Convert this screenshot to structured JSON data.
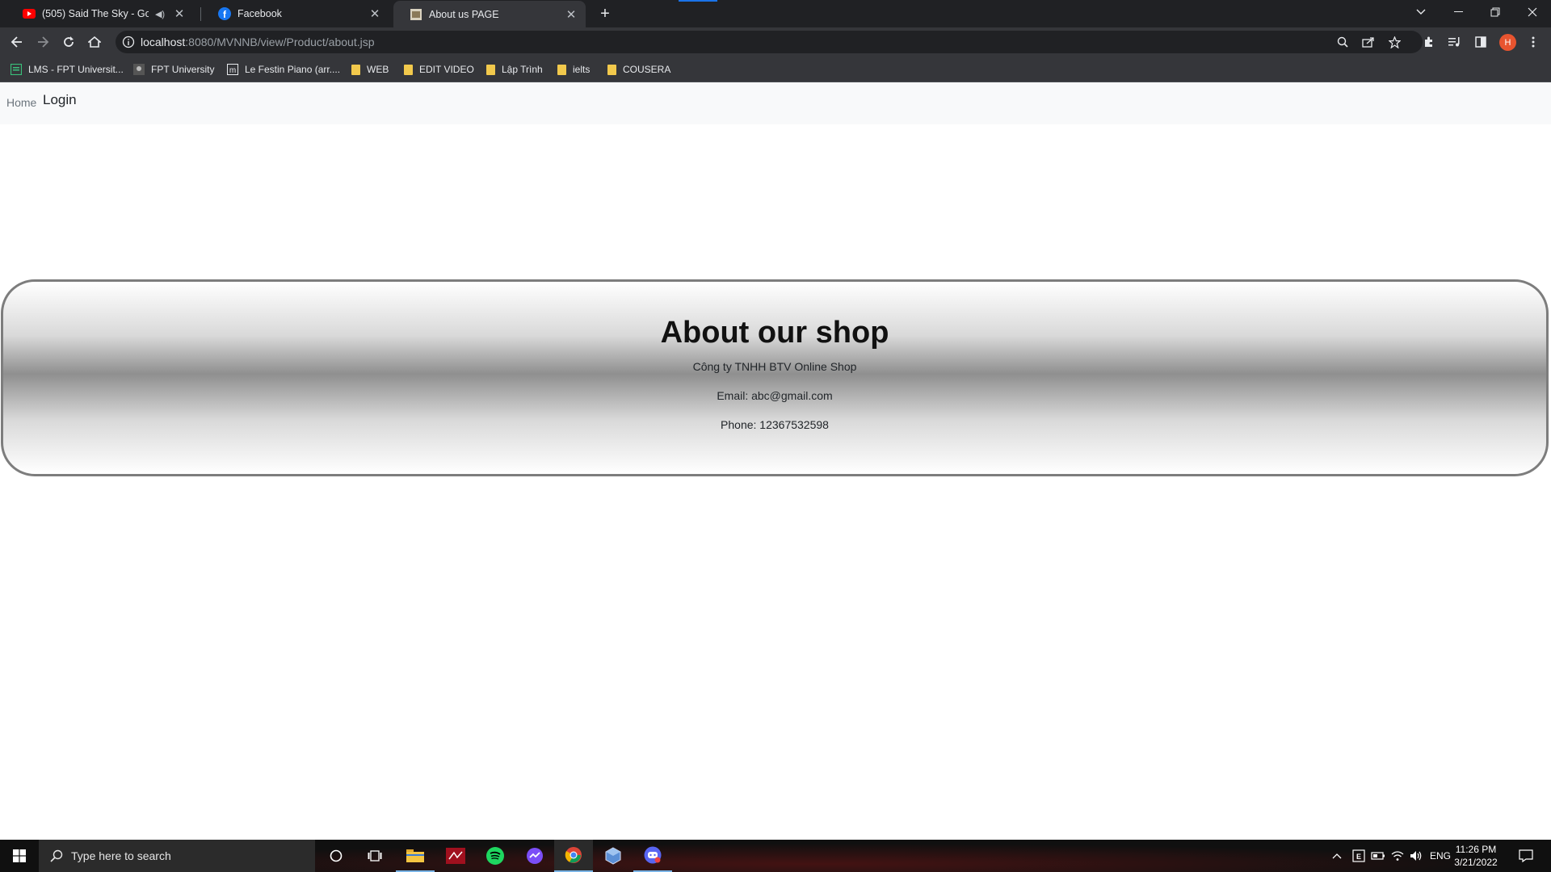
{
  "browser": {
    "tabs": [
      {
        "title": "(505) Said The Sky - Gold (Ly",
        "icon": "youtube-icon"
      },
      {
        "title": "Facebook",
        "icon": "facebook-icon"
      },
      {
        "title": "About us PAGE",
        "icon": "page-icon",
        "active": true
      }
    ],
    "address": {
      "host": "localhost",
      "path": ":8080/MVNNB/view/Product/about.jsp"
    },
    "avatar_letter": "H",
    "bookmarks": [
      {
        "label": "LMS - FPT Universit...",
        "icon": "lms-icon"
      },
      {
        "label": "FPT University",
        "icon": "fpt-icon"
      },
      {
        "label": "Le Festin Piano (arr....",
        "icon": "music-icon"
      },
      {
        "label": "WEB",
        "icon": "folder-icon"
      },
      {
        "label": "EDIT VIDEO",
        "icon": "folder-icon"
      },
      {
        "label": "Lập Trình",
        "icon": "folder-icon"
      },
      {
        "label": "ielts",
        "icon": "folder-icon"
      },
      {
        "label": "COUSERA",
        "icon": "folder-icon"
      }
    ]
  },
  "page": {
    "nav": {
      "home": "Home",
      "login": "Login"
    },
    "about": {
      "title": "About our shop",
      "company": "Công ty TNHH BTV Online Shop",
      "email": "Email: abc@gmail.com",
      "phone": "Phone: 12367532598"
    }
  },
  "taskbar": {
    "search_placeholder": "Type here to search",
    "language": "ENG",
    "time": "11:26 PM",
    "date": "3/21/2022"
  },
  "colors": {
    "chrome_dark": "#202124",
    "chrome_toolbar": "#35363a",
    "navbar_bg": "#f8f9fa",
    "box_border": "#7d7d7d",
    "accent_blue": "#1a73e8"
  }
}
